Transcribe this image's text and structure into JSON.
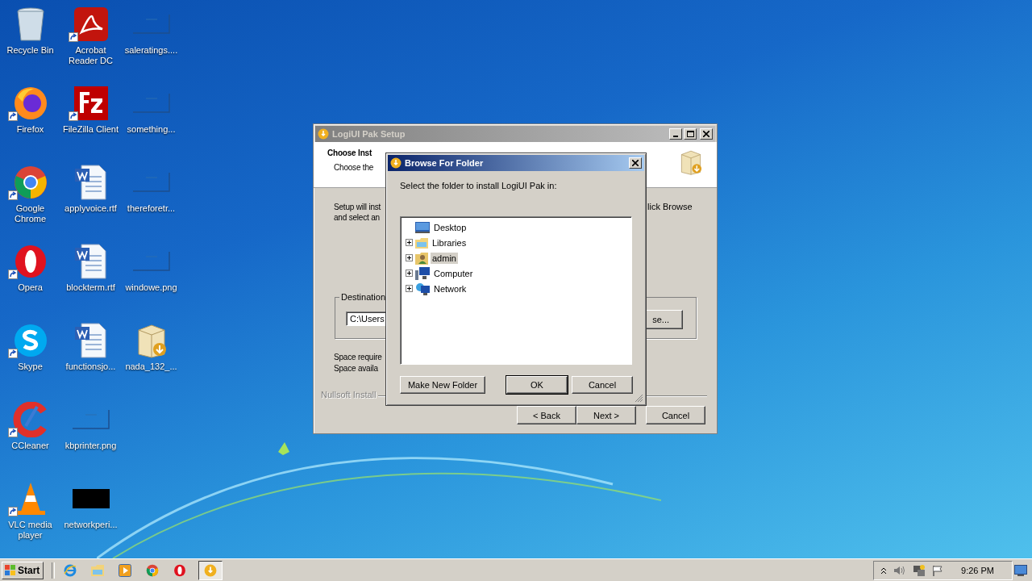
{
  "desktop": {
    "icons": [
      {
        "label": "Recycle Bin",
        "kind": "recycle",
        "shortcut": false
      },
      {
        "label": "Firefox",
        "kind": "firefox",
        "shortcut": true
      },
      {
        "label": "Google Chrome",
        "kind": "chrome",
        "shortcut": true
      },
      {
        "label": "Opera",
        "kind": "opera",
        "shortcut": true
      },
      {
        "label": "Skype",
        "kind": "skype",
        "shortcut": true
      },
      {
        "label": "CCleaner",
        "kind": "ccleaner",
        "shortcut": true
      },
      {
        "label": "VLC media player",
        "kind": "vlc",
        "shortcut": true
      },
      {
        "label": "Acrobat Reader DC",
        "kind": "acrobat",
        "shortcut": true
      },
      {
        "label": "FileZilla Client",
        "kind": "filezilla",
        "shortcut": true
      },
      {
        "label": "applyvoice.rtf",
        "kind": "word",
        "shortcut": false
      },
      {
        "label": "blockterm.rtf",
        "kind": "word",
        "shortcut": false
      },
      {
        "label": "functionsjo...",
        "kind": "word",
        "shortcut": false
      },
      {
        "label": "kbprinter.png",
        "kind": "blank",
        "shortcut": false
      },
      {
        "label": "networkperi...",
        "kind": "black",
        "shortcut": false
      },
      {
        "label": "saleratings....",
        "kind": "blank",
        "shortcut": false
      },
      {
        "label": "something...",
        "kind": "blank",
        "shortcut": false
      },
      {
        "label": "thereforetr...",
        "kind": "blank",
        "shortcut": false
      },
      {
        "label": "windowe.png",
        "kind": "blank",
        "shortcut": false
      },
      {
        "label": "nada_132_...",
        "kind": "installer",
        "shortcut": false
      }
    ]
  },
  "setup_window": {
    "title": "LogiUI Pak Setup",
    "active": false,
    "header_title": "Choose Inst",
    "header_subtitle": "Choose the",
    "body_left": [
      "Setup will inst",
      "and select an"
    ],
    "body_right": "lick Browse",
    "destination_label": "Destination",
    "destination_value": "C:\\Users",
    "browse_button": "se...",
    "space_lines": [
      "Space require",
      "Space availa"
    ],
    "branding": "Nullsoft Install",
    "buttons": [
      {
        "label": "< Back"
      },
      {
        "label": "Next >"
      },
      {
        "label": "Cancel"
      }
    ]
  },
  "browse_dialog": {
    "title": "Browse For Folder",
    "active": true,
    "prompt": "Select the folder to install LogiUI Pak in:",
    "tree": [
      {
        "label": "Desktop",
        "kind": "desktop",
        "selected": false,
        "children": [
          {
            "label": "Libraries",
            "kind": "libraries",
            "expanded": false,
            "selected": false
          },
          {
            "label": "admin",
            "kind": "user",
            "expanded": false,
            "selected": true
          },
          {
            "label": "Computer",
            "kind": "computer",
            "expanded": false,
            "selected": false
          },
          {
            "label": "Network",
            "kind": "network",
            "expanded": false,
            "selected": false
          }
        ]
      }
    ],
    "buttons": [
      {
        "label": "Make New Folder",
        "default": false
      },
      {
        "label": "OK",
        "default": true
      },
      {
        "label": "Cancel",
        "default": false
      }
    ]
  },
  "taskbar": {
    "start_label": "Start",
    "items": [
      {
        "kind": "ie",
        "active": false
      },
      {
        "kind": "explorer",
        "active": false
      },
      {
        "kind": "media",
        "active": false
      },
      {
        "kind": "chrome",
        "active": false
      },
      {
        "kind": "opera",
        "active": false
      },
      {
        "kind": "installer",
        "active": true
      }
    ],
    "clock": "9:26 PM"
  }
}
